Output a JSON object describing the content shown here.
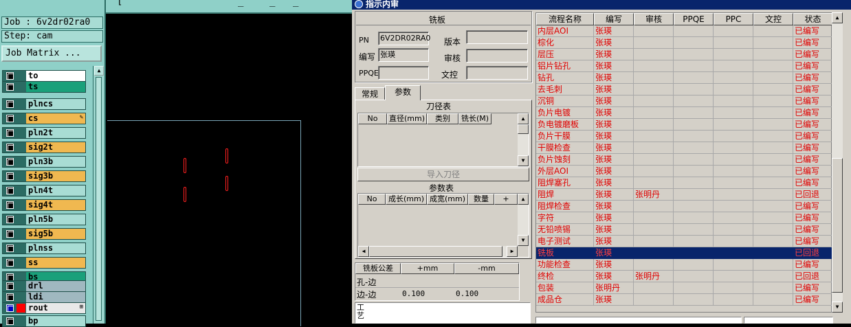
{
  "left_panel": {
    "top_strip_glyphs": [
      "_",
      "_",
      "_",
      "[",
      "_",
      "_",
      "_"
    ],
    "job_label": "Job : 6v2dr02ra0",
    "step_label": "Step: cam",
    "job_matrix_button": "Job Matrix ...",
    "layers": [
      {
        "name": "to",
        "color": "#ffffff",
        "mark": ""
      },
      {
        "name": "ts",
        "color": "#1aa07a",
        "mark": ""
      },
      {
        "name": "plncs",
        "color": "#a8dcd4",
        "mark": ""
      },
      {
        "name": "cs",
        "color": "#f0b850",
        "mark": "✎"
      },
      {
        "name": "pln2t",
        "color": "#a8dcd4",
        "mark": ""
      },
      {
        "name": "sig2t",
        "color": "#f0b850",
        "mark": ""
      },
      {
        "name": "pln3b",
        "color": "#a8dcd4",
        "mark": ""
      },
      {
        "name": "sig3b",
        "color": "#f0b850",
        "mark": ""
      },
      {
        "name": "pln4t",
        "color": "#a8dcd4",
        "mark": ""
      },
      {
        "name": "sig4t",
        "color": "#f0b850",
        "mark": ""
      },
      {
        "name": "pln5b",
        "color": "#a8dcd4",
        "mark": ""
      },
      {
        "name": "sig5b",
        "color": "#f0b850",
        "mark": ""
      },
      {
        "name": "plnss",
        "color": "#a8dcd4",
        "mark": ""
      },
      {
        "name": "ss",
        "color": "#f0b850",
        "mark": ""
      },
      {
        "name": "bs",
        "color": "#1aa07a",
        "mark": ""
      },
      {
        "name": "drl",
        "color": "#a0b8c0",
        "mark": ""
      },
      {
        "name": "ldi",
        "color": "#a0b8c0",
        "mark": ""
      },
      {
        "name": "rout",
        "color": "#e8e8e8",
        "mark": "⊞"
      },
      {
        "name": "bp",
        "color": "#a8dcd4",
        "mark": ""
      }
    ]
  },
  "dialog": {
    "title": "指示内审",
    "section_title": "铣板",
    "pn_label": "PN",
    "pn_value": "6V2DR02RA0",
    "version_label": "版本",
    "author_label": "编写",
    "author_value": "张瑛",
    "review_label": "审核",
    "ppqe_label": "PPQE",
    "check_label": "文控",
    "tabs": [
      "常规",
      "参数"
    ],
    "tool_table_title": "刀径表",
    "tool_headers": [
      "No",
      "直径(mm)",
      "类别",
      "铣长(M)"
    ],
    "import_button": "导入刀径",
    "param_table_title": "参数表",
    "param_headers": [
      "No",
      "成长(mm)",
      "成宽(mm)",
      "数量",
      "+"
    ],
    "tolerance_headers": [
      "铣板公差",
      "+mm",
      "-mm"
    ],
    "tolerance_rows": [
      {
        "name": "孔-边",
        "plus": "",
        "minus": ""
      },
      {
        "name": "边-边",
        "plus": "0.100",
        "minus": "0.100"
      }
    ],
    "process_label": "工艺"
  },
  "flow_table": {
    "headers": [
      "流程名称",
      "编写",
      "审核",
      "PPQE",
      "PPC",
      "文控",
      "状态"
    ],
    "rows": [
      {
        "name": "内层AOI",
        "author": "张瑛",
        "review": "",
        "status": "已编写"
      },
      {
        "name": "棕化",
        "author": "张瑛",
        "review": "",
        "status": "已编写"
      },
      {
        "name": "层压",
        "author": "张瑛",
        "review": "",
        "status": "已编写"
      },
      {
        "name": "铝片钻孔",
        "author": "张瑛",
        "review": "",
        "status": "已编写"
      },
      {
        "name": "钻孔",
        "author": "张瑛",
        "review": "",
        "status": "已编写"
      },
      {
        "name": "去毛刺",
        "author": "张瑛",
        "review": "",
        "status": "已编写"
      },
      {
        "name": "沉铜",
        "author": "张瑛",
        "review": "",
        "status": "已编写"
      },
      {
        "name": "负片电镀",
        "author": "张瑛",
        "review": "",
        "status": "已编写"
      },
      {
        "name": "负电镀磨板",
        "author": "张瑛",
        "review": "",
        "status": "已编写"
      },
      {
        "name": "负片干膜",
        "author": "张瑛",
        "review": "",
        "status": "已编写"
      },
      {
        "name": "干膜检查",
        "author": "张瑛",
        "review": "",
        "status": "已编写"
      },
      {
        "name": "负片蚀刻",
        "author": "张瑛",
        "review": "",
        "status": "已编写"
      },
      {
        "name": "外层AOI",
        "author": "张瑛",
        "review": "",
        "status": "已编写"
      },
      {
        "name": "阻焊塞孔",
        "author": "张瑛",
        "review": "",
        "status": "已编写"
      },
      {
        "name": "阻焊",
        "author": "张瑛",
        "review": "张明丹",
        "status": "已回退"
      },
      {
        "name": "阻焊检查",
        "author": "张瑛",
        "review": "",
        "status": "已编写"
      },
      {
        "name": "字符",
        "author": "张瑛",
        "review": "",
        "status": "已编写"
      },
      {
        "name": "无铅喷锡",
        "author": "张瑛",
        "review": "",
        "status": "已编写"
      },
      {
        "name": "电子测试",
        "author": "张瑛",
        "review": "",
        "status": "已编写"
      },
      {
        "name": "铣板",
        "author": "张瑛",
        "review": "",
        "status": "已回退",
        "selected": true
      },
      {
        "name": "功能检查",
        "author": "张瑛",
        "review": "",
        "status": "已编写"
      },
      {
        "name": "终检",
        "author": "张瑛",
        "review": "张明丹",
        "status": "已回退"
      },
      {
        "name": "包装",
        "author": "张明丹",
        "review": "",
        "status": "已编写"
      },
      {
        "name": "成品仓",
        "author": "张瑛",
        "review": "",
        "status": "已编写"
      }
    ]
  }
}
